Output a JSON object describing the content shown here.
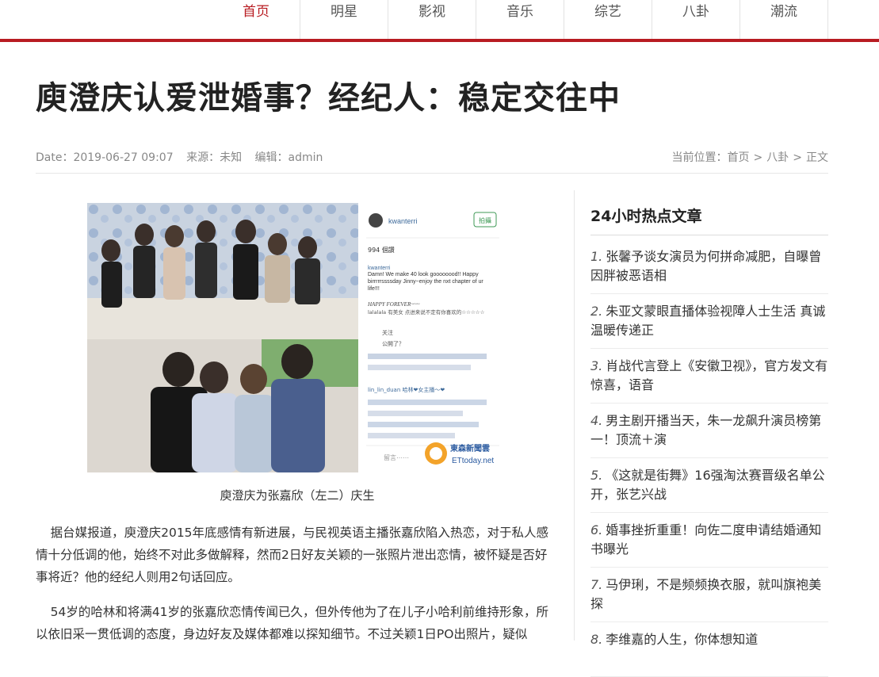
{
  "nav": {
    "items": [
      "首页",
      "明星",
      "影视",
      "音乐",
      "综艺",
      "八卦",
      "潮流"
    ],
    "active_index": 0,
    "accent_color": "#b81c22"
  },
  "article": {
    "title": "庾澄庆认爱泄婚事？经纪人：稳定交往中",
    "meta": {
      "date": "Date：2019-06-27 09:07",
      "source": "来源：未知",
      "editor": "编辑：admin"
    },
    "breadcrumb": {
      "label": "当前位置：",
      "items": [
        "首页",
        "八卦",
        "正文"
      ],
      "separator": ">"
    },
    "image": {
      "phone_username": "kwanterri",
      "phone_button": "拍攝",
      "likes": "994 個讚",
      "comment_user": "kwanterri",
      "comment_text": "Damn! We make 40 look goooooood!! Happy birrrrrssssday Jinny~enjoy the nxt chapter of ur life!!!",
      "happy_forever": "HAPPY FOREVER~~~",
      "lala_line": "lalalala 有美女 点进来说不定有你喜欢的☆☆☆☆☆",
      "follow_line": "关注",
      "reveal_line": "公開了？",
      "lin_line": "lin_lin_duan 哈林❤︎女主播～❤︎",
      "reply_placeholder": "留言⋯⋯",
      "watermark_cn": "東森新聞雲",
      "watermark_en": "ETtoday.net"
    },
    "caption": "庾澄庆为张嘉欣（左二）庆生",
    "paragraphs": [
      "据台媒报道，庾澄庆2015年底感情有新进展，与民视英语主播张嘉欣陷入热恋，对于私人感情十分低调的他，始终不对此多做解释，然而2日好友关颖的一张照片泄出恋情，被怀疑是否好事将近？他的经纪人则用2句话回应。",
      "54岁的哈林和将满41岁的张嘉欣恋情传闻已久，但外传他为了在儿子小哈利前维持形象，所以依旧采一贯低调的态度，身边好友及媒体都难以探知细节。不过关颖1日PO出照片，疑似"
    ]
  },
  "sidebar": {
    "title": "24小时热点文章",
    "items": [
      {
        "num": "1.",
        "text": "张馨予谈女演员为何拼命减肥，自曝曾因胖被恶语相"
      },
      {
        "num": "2.",
        "text": "朱亚文蒙眼直播体验视障人士生活 真诚温暖传递正"
      },
      {
        "num": "3.",
        "text": "肖战代言登上《安徽卫视》，官方发文有惊喜，语音"
      },
      {
        "num": "4.",
        "text": "男主剧开播当天，朱一龙飙升演员榜第一！顶流＋演"
      },
      {
        "num": "5.",
        "text": "《这就是街舞》16强淘汰赛晋级名单公开，张艺兴战"
      },
      {
        "num": "6.",
        "text": "婚事挫折重重！向佐二度申请结婚通知书曝光"
      },
      {
        "num": "7.",
        "text": "马伊琍，不是频频换衣服，就叫旗袍美探"
      },
      {
        "num": "8.",
        "text": "李维嘉的人生，你体想知道"
      }
    ]
  }
}
